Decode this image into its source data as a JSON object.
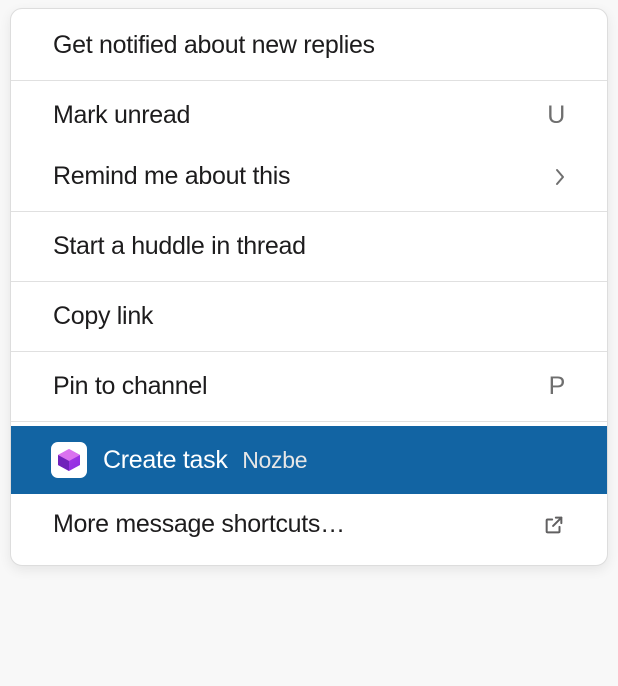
{
  "menu": {
    "items": [
      {
        "label": "Get notified about new replies"
      },
      {
        "label": "Mark unread",
        "shortcut": "U"
      },
      {
        "label": "Remind me about this",
        "submenu": true
      },
      {
        "label": "Start a huddle in thread"
      },
      {
        "label": "Copy link"
      },
      {
        "label": "Pin to channel",
        "shortcut": "P"
      },
      {
        "label": "Create task",
        "app_name": "Nozbe",
        "highlighted": true,
        "app_icon": "nozbe"
      },
      {
        "label": "More message shortcuts…",
        "external": true
      }
    ]
  }
}
